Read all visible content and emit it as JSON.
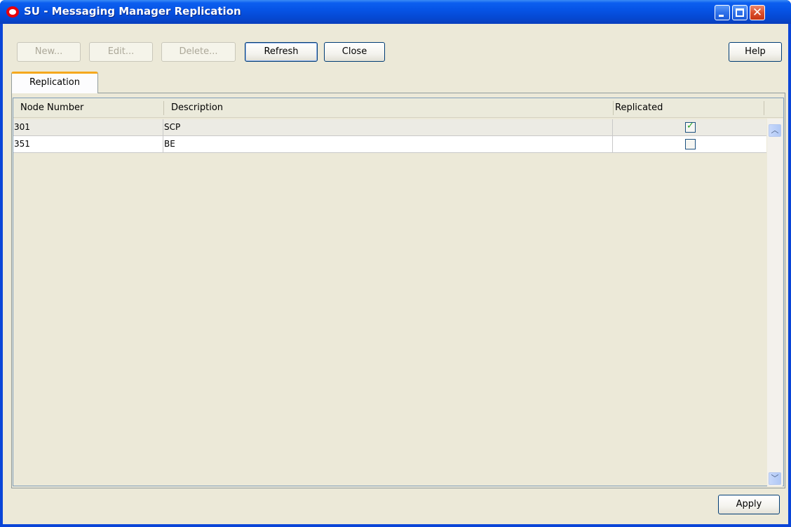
{
  "window": {
    "title": "SU - Messaging Manager Replication",
    "controls": {
      "minimize": "_",
      "maximize": "□",
      "close": "✕"
    }
  },
  "toolbar": {
    "new_label": "New...",
    "edit_label": "Edit...",
    "delete_label": "Delete...",
    "refresh_label": "Refresh",
    "close_label": "Close",
    "help_label": "Help"
  },
  "tabs": [
    {
      "label": "Replication",
      "active": true
    }
  ],
  "table": {
    "columns": [
      "Node Number",
      "Description",
      "Replicated"
    ],
    "rows": [
      {
        "node_number": "301",
        "description": "SCP",
        "replicated": true
      },
      {
        "node_number": "351",
        "description": "BE",
        "replicated": false
      }
    ]
  },
  "footer": {
    "apply_label": "Apply"
  },
  "icons": {
    "app": "oracle-logo-icon",
    "scroll_up": "chevron-up-icon",
    "scroll_down": "chevron-down-icon",
    "check": "check-icon"
  },
  "colors": {
    "titlebar": "#0654e6",
    "client_bg": "#ece9d8",
    "tab_accent": "#f5a81e",
    "check_green": "#21a121"
  }
}
